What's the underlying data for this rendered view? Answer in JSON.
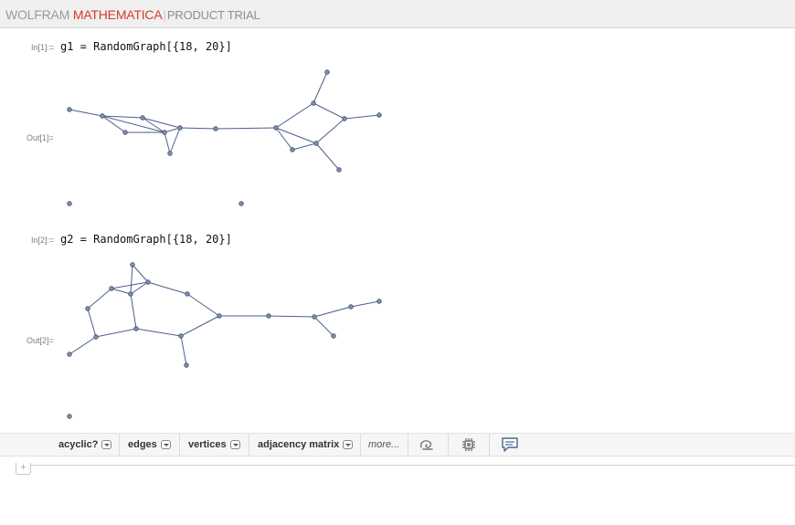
{
  "header": {
    "brand_part1": "WOLFRAM",
    "brand_part2": "MATHEMATICA",
    "separator": "|",
    "brand_part3": "PRODUCT TRIAL"
  },
  "cells": [
    {
      "in_label": "In[1]:=",
      "code": "g1 = RandomGraph[{18, 20}]",
      "out_label": "Out[1]="
    },
    {
      "in_label": "In[2]:=",
      "code": "g2 = RandomGraph[{18, 20}]",
      "out_label": "Out[2]="
    }
  ],
  "toolbar": {
    "buttons": [
      "acyclic?",
      "edges",
      "vertices",
      "adjacency matrix"
    ],
    "more": "more...",
    "icons": [
      "spiral-icon",
      "gear-icon",
      "comment-icon"
    ]
  },
  "colors": {
    "brand_red": "#d63b2a",
    "edge": "#4a5f8a",
    "vertex_fill": "#8391b0"
  }
}
